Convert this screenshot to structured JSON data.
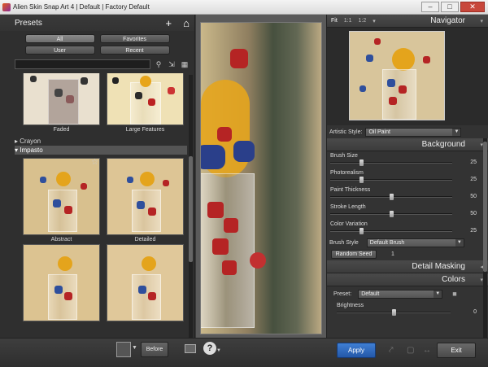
{
  "window": {
    "title": "Alien Skin Snap Art 4 | Default | Factory Default",
    "controls": [
      "–",
      "□",
      "✕"
    ]
  },
  "presets": {
    "title": "Presets",
    "add_icon": "+",
    "home_icon": "⌂",
    "filters": [
      "All",
      "Favorites",
      "User",
      "Recent"
    ],
    "search_placeholder": "",
    "top_thumbs": [
      "Faded",
      "Large Features"
    ],
    "categories": [
      "Crayon",
      "Impasto"
    ],
    "impasto_thumbs": [
      "Abstract",
      "Detailed"
    ],
    "cat_arrow_closed": "▸",
    "cat_arrow_open": "▾",
    "star": "☆"
  },
  "navigator": {
    "title": "Navigator",
    "zoom": [
      "Fit",
      "1:1",
      "1:2"
    ],
    "zoom_dropdown": "▾",
    "collapse": "▾"
  },
  "artistic_style": {
    "label": "Artistic Style:",
    "value": "Oil Paint"
  },
  "background": {
    "title": "Background",
    "sliders": [
      {
        "label": "Brush Size",
        "value": "25",
        "level": 0.25
      },
      {
        "label": "Photorealism",
        "value": "25",
        "level": 0.25
      },
      {
        "label": "Paint Thickness",
        "value": "50",
        "level": 0.5
      },
      {
        "label": "Stroke Length",
        "value": "50",
        "level": 0.5
      },
      {
        "label": "Color Variation",
        "value": "25",
        "level": 0.25
      }
    ],
    "brush_style_label": "Brush Style",
    "brush_style_value": "Default Brush",
    "random_seed_label": "Random Seed",
    "random_seed_value": "1"
  },
  "detail_masking": {
    "title": "Detail Masking",
    "arrow": "◂"
  },
  "colors": {
    "title": "Colors",
    "arrow": "▾",
    "preset_label": "Preset:",
    "preset_value": "Default",
    "brightness_label": "Brightness",
    "brightness_value": "0",
    "brightness_level": 0.5
  },
  "bottom": {
    "before_label": "Before",
    "apply_label": "Apply",
    "exit_label": "Exit",
    "help": "?"
  },
  "colors_theme": {
    "apply": "#2f6cc0",
    "panel": "#333333"
  }
}
